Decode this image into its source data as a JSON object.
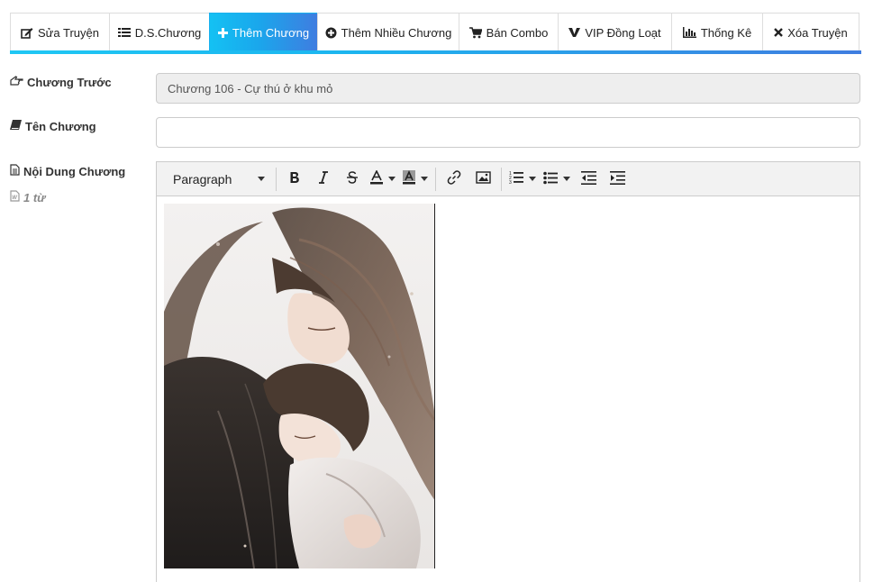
{
  "tabs": [
    {
      "label": "Sửa Truyện",
      "icon": "edit-icon",
      "active": false
    },
    {
      "label": "D.S.Chương",
      "icon": "list-icon",
      "active": false
    },
    {
      "label": "Thêm Chương",
      "icon": "plus-icon",
      "active": true
    },
    {
      "label": "Thêm Nhiều Chương",
      "icon": "plus-circle-icon",
      "active": false
    },
    {
      "label": "Bán Combo",
      "icon": "cart-icon",
      "active": false
    },
    {
      "label": "VIP Đồng Loạt",
      "icon": "vip-icon",
      "active": false
    },
    {
      "label": "Thống Kê",
      "icon": "bar-chart-icon",
      "active": false
    },
    {
      "label": "Xóa Truyện",
      "icon": "close-icon",
      "active": false
    }
  ],
  "form": {
    "prev_chapter_label": "Chương Trước",
    "prev_chapter_value": "Chương 106 - Cự thú ở khu mỏ",
    "chapter_name_label": "Tên Chương",
    "chapter_name_value": "",
    "content_label": "Nội Dung Chương",
    "word_count": "1 từ"
  },
  "editor": {
    "block_format": "Paragraph",
    "tools": [
      "bold-icon",
      "italic-icon",
      "strikethrough-icon",
      "text-color-icon",
      "background-color-icon",
      "link-icon",
      "image-icon",
      "ordered-list-icon",
      "unordered-list-icon",
      "outdent-icon",
      "indent-icon"
    ]
  },
  "colors": {
    "accent_start": "#14c1f3",
    "accent_end": "#3f7de0"
  }
}
